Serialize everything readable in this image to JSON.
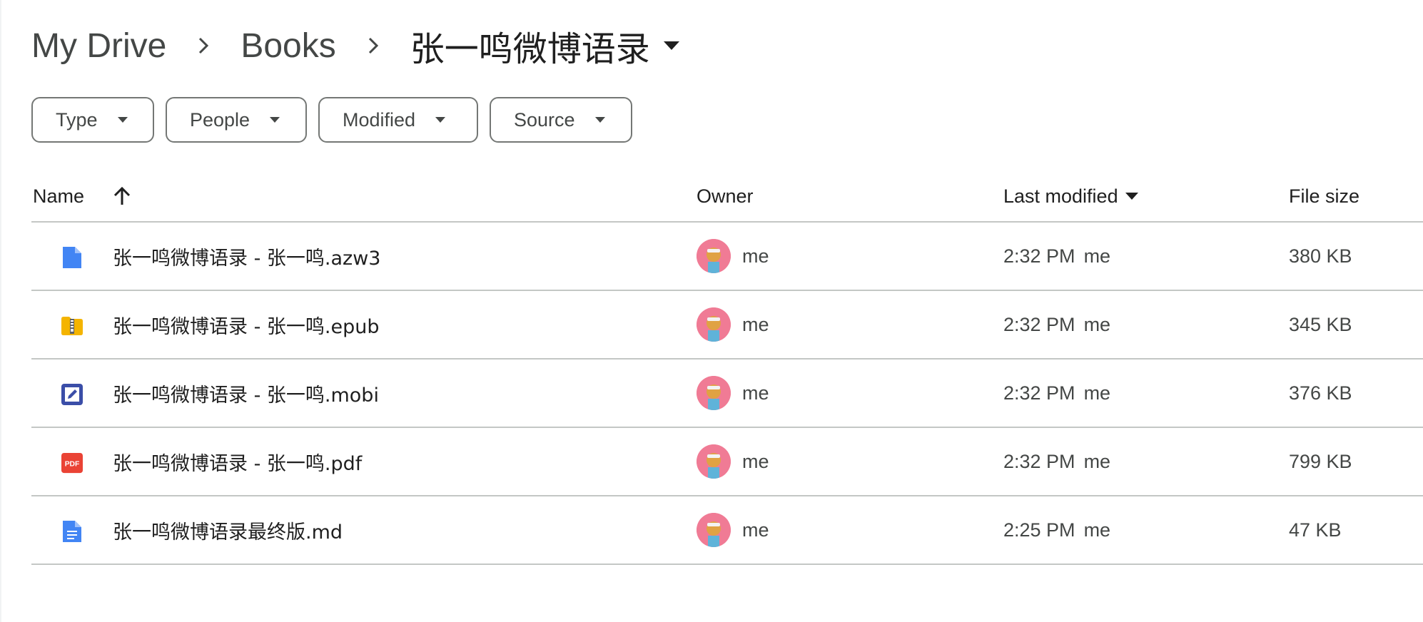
{
  "breadcrumb": {
    "root": "My Drive",
    "parent": "Books",
    "current": "张一鸣微博语录"
  },
  "filters": [
    {
      "label": "Type"
    },
    {
      "label": "People"
    },
    {
      "label": "Modified"
    },
    {
      "label": "Source"
    }
  ],
  "table": {
    "headers": {
      "name": "Name",
      "owner": "Owner",
      "last_modified": "Last modified",
      "file_size": "File size"
    },
    "rows": [
      {
        "icon": "azw3-doc-icon",
        "name": "张一鸣微博语录 - 张一鸣.azw3",
        "owner": "me",
        "time": "2:32 PM",
        "modified_by": "me",
        "size": "380 KB"
      },
      {
        "icon": "archive-zip-icon",
        "name": "张一鸣微博语录 - 张一鸣.epub",
        "owner": "me",
        "time": "2:32 PM",
        "modified_by": "me",
        "size": "345 KB"
      },
      {
        "icon": "image-edit-icon",
        "name": "张一鸣微博语录 - 张一鸣.mobi",
        "owner": "me",
        "time": "2:32 PM",
        "modified_by": "me",
        "size": "376 KB"
      },
      {
        "icon": "pdf-icon",
        "name": "张一鸣微博语录 - 张一鸣.pdf",
        "owner": "me",
        "time": "2:32 PM",
        "modified_by": "me",
        "size": "799 KB"
      },
      {
        "icon": "text-doc-icon",
        "name": "张一鸣微博语录最终版.md",
        "owner": "me",
        "time": "2:25 PM",
        "modified_by": "me",
        "size": "47 KB"
      }
    ]
  },
  "pdf_icon_text": "PDF",
  "colors": {
    "text_primary": "#1f1f1f",
    "text_secondary": "#444746",
    "divider": "#c4c7c5",
    "doc_blue": "#4285f4",
    "pdf_red": "#ea4335",
    "avatar_pink": "#f07b95"
  }
}
